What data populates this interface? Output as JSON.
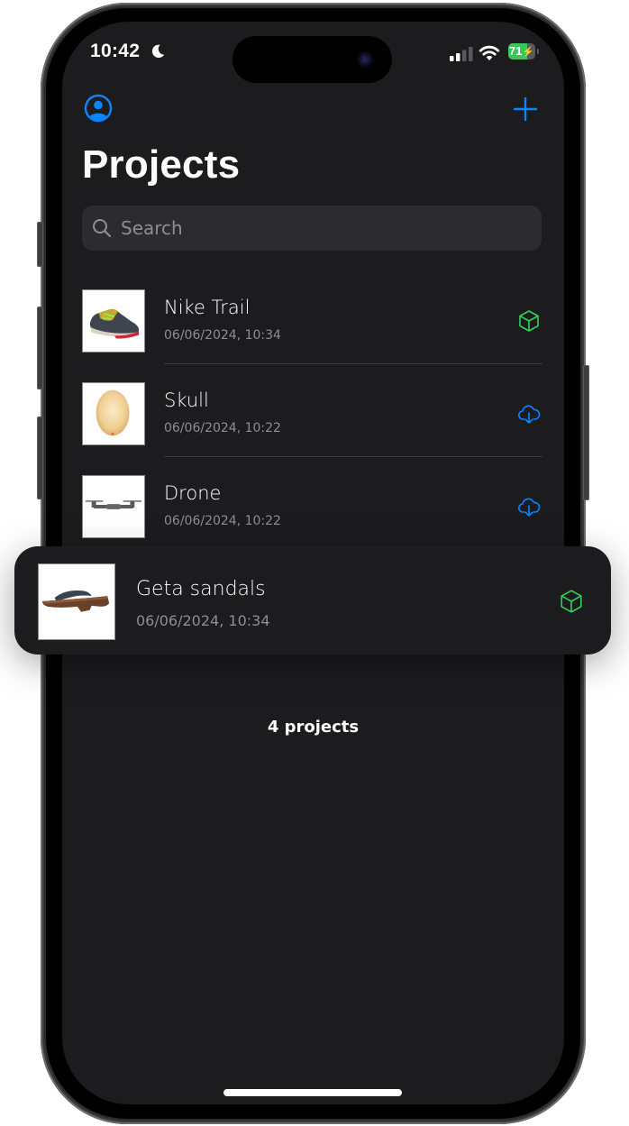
{
  "status_bar": {
    "time": "10:42",
    "focus_icon": "moon-icon",
    "signal_icon": "cellular-signal-icon",
    "wifi_icon": "wifi-icon",
    "battery_level": "71",
    "battery_fraction": 0.71,
    "battery_charging": true
  },
  "nav": {
    "profile_icon": "person-circle-icon",
    "add_icon": "plus-icon",
    "accent_color": "#0a84ff"
  },
  "page": {
    "title": "Projects"
  },
  "search": {
    "placeholder": "Search",
    "value": ""
  },
  "projects": [
    {
      "name": "Nike Trail",
      "date": "06/06/2024, 10:34",
      "thumbnail": "sneaker",
      "status_icon": "cube-icon",
      "status": "local",
      "status_color": "#30d158"
    },
    {
      "name": "Skull",
      "date": "06/06/2024, 10:22",
      "thumbnail": "skull",
      "status_icon": "cloud-download-icon",
      "status": "cloud",
      "status_color": "#0a84ff"
    },
    {
      "name": "Drone",
      "date": "06/06/2024, 10:22",
      "thumbnail": "drone",
      "status_icon": "cloud-download-icon",
      "status": "cloud",
      "status_color": "#0a84ff"
    }
  ],
  "dragged_project": {
    "name": "Geta sandals",
    "date": "06/06/2024, 10:34",
    "thumbnail": "sandal",
    "status_icon": "cube-icon",
    "status": "local",
    "status_color": "#30d158"
  },
  "footer": {
    "count_label": "4 projects"
  }
}
